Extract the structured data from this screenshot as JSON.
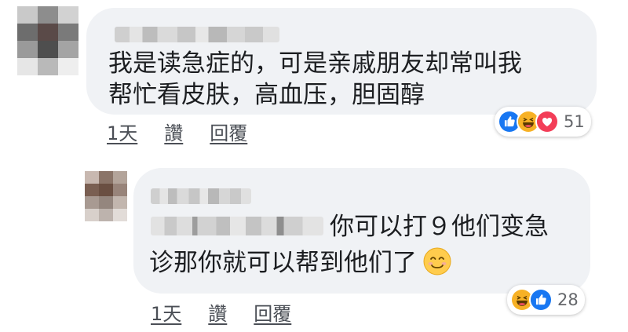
{
  "comments": [
    {
      "text_lines": [
        "我是读急症的，可是亲戚朋友却常叫我",
        "帮忙看皮肤，高血压，胆固醇"
      ],
      "actions": {
        "time": "1天",
        "like": "讚",
        "reply": "回覆"
      },
      "reactions": {
        "icons": [
          "like-icon",
          "haha-icon",
          "love-icon"
        ],
        "count": "51"
      }
    },
    {
      "text_line1": "你可以打９他们变急",
      "text_line2": "诊那你就可以帮到他们了",
      "emoji": "smiling-face-emoji",
      "actions": {
        "time": "1天",
        "like": "讚",
        "reply": "回覆"
      },
      "reactions": {
        "icons": [
          "haha-icon",
          "like-icon"
        ],
        "count": "28"
      }
    }
  ],
  "colors": {
    "bubble": "#f0f2f5",
    "like": "#1877f2",
    "love": "#f33e58",
    "haha": "#f7b125"
  }
}
